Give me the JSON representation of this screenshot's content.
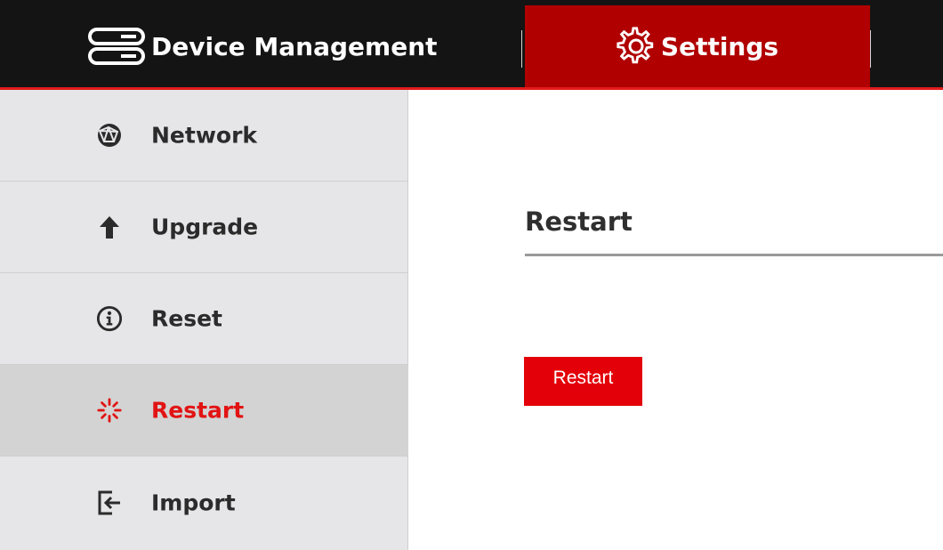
{
  "header": {
    "tabs": [
      {
        "label": "Device Management",
        "icon": "server-icon",
        "active": false
      },
      {
        "label": "Settings",
        "icon": "gear-icon",
        "active": true
      }
    ]
  },
  "sidebar": {
    "items": [
      {
        "label": "Network",
        "icon": "globe-icon",
        "active": false
      },
      {
        "label": "Upgrade",
        "icon": "arrow-up-icon",
        "active": false
      },
      {
        "label": "Reset",
        "icon": "info-icon",
        "active": false
      },
      {
        "label": "Restart",
        "icon": "spinner-icon",
        "active": true
      },
      {
        "label": "Import",
        "icon": "import-icon",
        "active": false
      }
    ]
  },
  "main": {
    "title": "Restart",
    "button_label": "Restart"
  },
  "colors": {
    "topbar": "#141414",
    "active_tab": "#b00000",
    "accent": "#e30008",
    "sidebar_bg": "#e6e6e8",
    "sidebar_active_bg": "#d3d3d3"
  }
}
